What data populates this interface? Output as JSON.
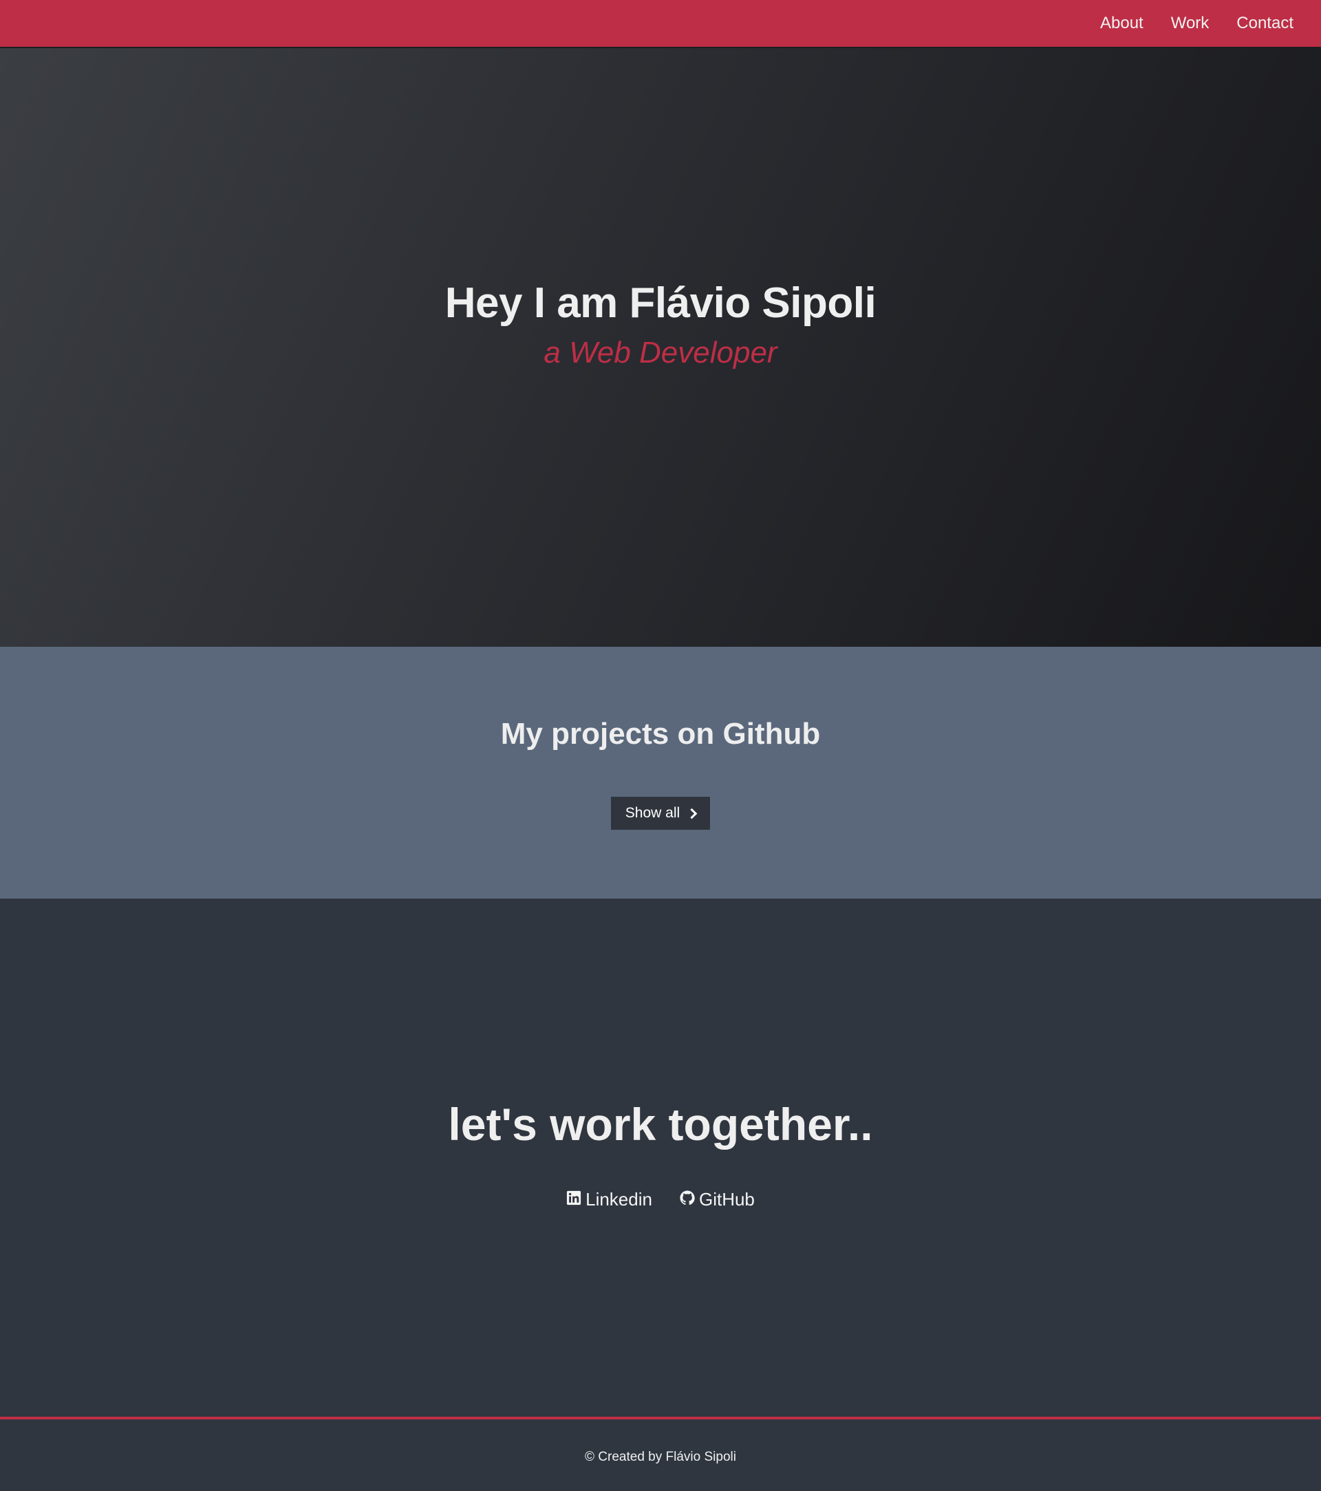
{
  "navbar": {
    "links": [
      {
        "label": "About"
      },
      {
        "label": "Work"
      },
      {
        "label": "Contact"
      }
    ]
  },
  "hero": {
    "title": "Hey I am Flávio Sipoli",
    "subtitle": "a Web Developer"
  },
  "projects": {
    "title": "My projects on Github",
    "show_all_label": "Show all",
    "show_all_icon": "chevron-right-icon"
  },
  "contact": {
    "title": "let's work together..",
    "links": [
      {
        "label": "Linkedin",
        "icon": "linkedin-icon"
      },
      {
        "label": "GitHub",
        "icon": "github-icon"
      }
    ]
  },
  "footer": {
    "text": "© Created by Flávio Sipoli"
  },
  "colors": {
    "accent": "#be2e46",
    "projects_bg": "#5b687c",
    "dark_bg": "#2f3640",
    "button_bg": "#30353d"
  }
}
